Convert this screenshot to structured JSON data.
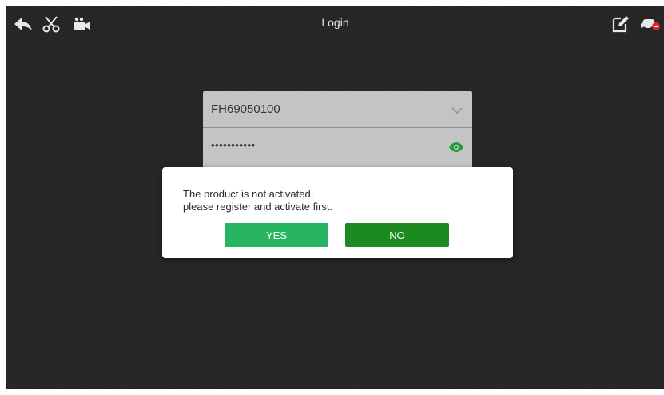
{
  "app": {
    "title": "Login"
  },
  "toolbar": {
    "left_icons": [
      "back-icon",
      "scissors-icon",
      "video-camera-icon"
    ],
    "right_icons": [
      "edit-icon",
      "car-disconnect-icon"
    ]
  },
  "login": {
    "username": "FH69050100",
    "password_masked": "•••••••••••"
  },
  "dialog": {
    "line1": "The product is not activated,",
    "line2": "please register and activate first.",
    "yes_label": "YES",
    "no_label": "NO"
  },
  "colors": {
    "background": "#262626",
    "yes_button": "#27b562",
    "no_button": "#1c8a20",
    "eye_icon": "#1e9e3a"
  }
}
